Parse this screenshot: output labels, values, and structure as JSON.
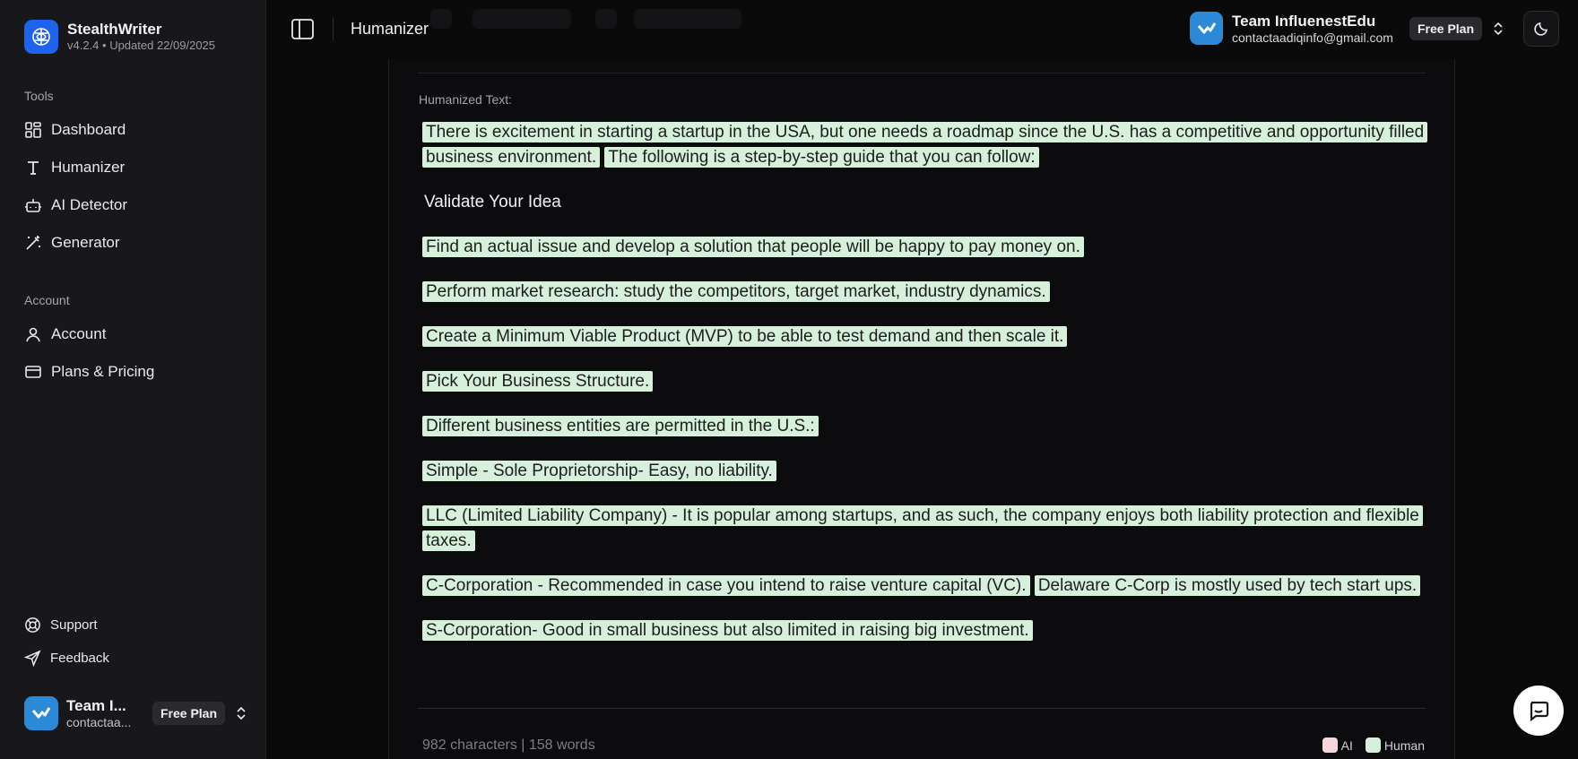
{
  "app": {
    "name": "StealthWriter",
    "version": "v4.2.4 • Updated 22/09/2025"
  },
  "sidebar": {
    "tools_label": "Tools",
    "tools": [
      {
        "label": "Dashboard",
        "icon": "dashboard-icon"
      },
      {
        "label": "Humanizer",
        "icon": "text-icon"
      },
      {
        "label": "AI Detector",
        "icon": "bot-icon"
      },
      {
        "label": "Generator",
        "icon": "wand-icon"
      }
    ],
    "account_label": "Account",
    "account_items": [
      {
        "label": "Account",
        "icon": "user-icon"
      },
      {
        "label": "Plans & Pricing",
        "icon": "card-icon"
      }
    ],
    "support_label": "Support",
    "feedback_label": "Feedback",
    "user": {
      "name": "Team I...",
      "email": "contactaa...",
      "plan": "Free Plan"
    }
  },
  "header": {
    "page_title": "Humanizer",
    "user": {
      "name": "Team InfluenestEdu",
      "email": "contactaadiqinfo@gmail.com",
      "plan": "Free Plan"
    }
  },
  "main": {
    "label": "Humanized Text:",
    "paragraphs": [
      {
        "type": "text",
        "segments": [
          "There is excitement in starting a startup in the USA, but one needs a roadmap since the U.S. has a competitive and opportunity filled business environment.",
          "The following is a step-by-step guide that you can follow:"
        ]
      },
      {
        "type": "heading",
        "text": "Validate Your Idea"
      },
      {
        "type": "text",
        "segments": [
          "Find an actual issue and develop a solution that people will be happy to pay money on."
        ]
      },
      {
        "type": "text",
        "segments": [
          "Perform market research: study the competitors, target market, industry dynamics."
        ]
      },
      {
        "type": "text",
        "segments": [
          "Create a Minimum Viable Product (MVP) to be able to test demand and then scale it."
        ]
      },
      {
        "type": "text",
        "segments": [
          "Pick Your Business Structure."
        ]
      },
      {
        "type": "text",
        "segments": [
          "Different business entities are permitted in the U.S.:"
        ]
      },
      {
        "type": "text",
        "segments": [
          "Simple - Sole Proprietorship- Easy, no liability."
        ]
      },
      {
        "type": "text",
        "segments": [
          "LLC (Limited Liability Company) - It is popular among startups, and as such, the company enjoys both liability protection and flexible taxes."
        ]
      },
      {
        "type": "text",
        "segments": [
          "C-Corporation - Recommended in case you intend to raise venture capital (VC).",
          "Delaware C-Corp is mostly used by tech start ups."
        ]
      },
      {
        "type": "text",
        "segments": [
          "S-Corporation- Good in small business but also limited in raising big investment."
        ]
      }
    ],
    "stats": "982 characters | 158 words",
    "legend": [
      {
        "label": "AI",
        "color": "#f6d5dc"
      },
      {
        "label": "Human",
        "color": "#d6f0dc"
      }
    ]
  },
  "colors": {
    "highlight_human": "#d6f0dc",
    "brand_blue": "#1e63f0"
  }
}
